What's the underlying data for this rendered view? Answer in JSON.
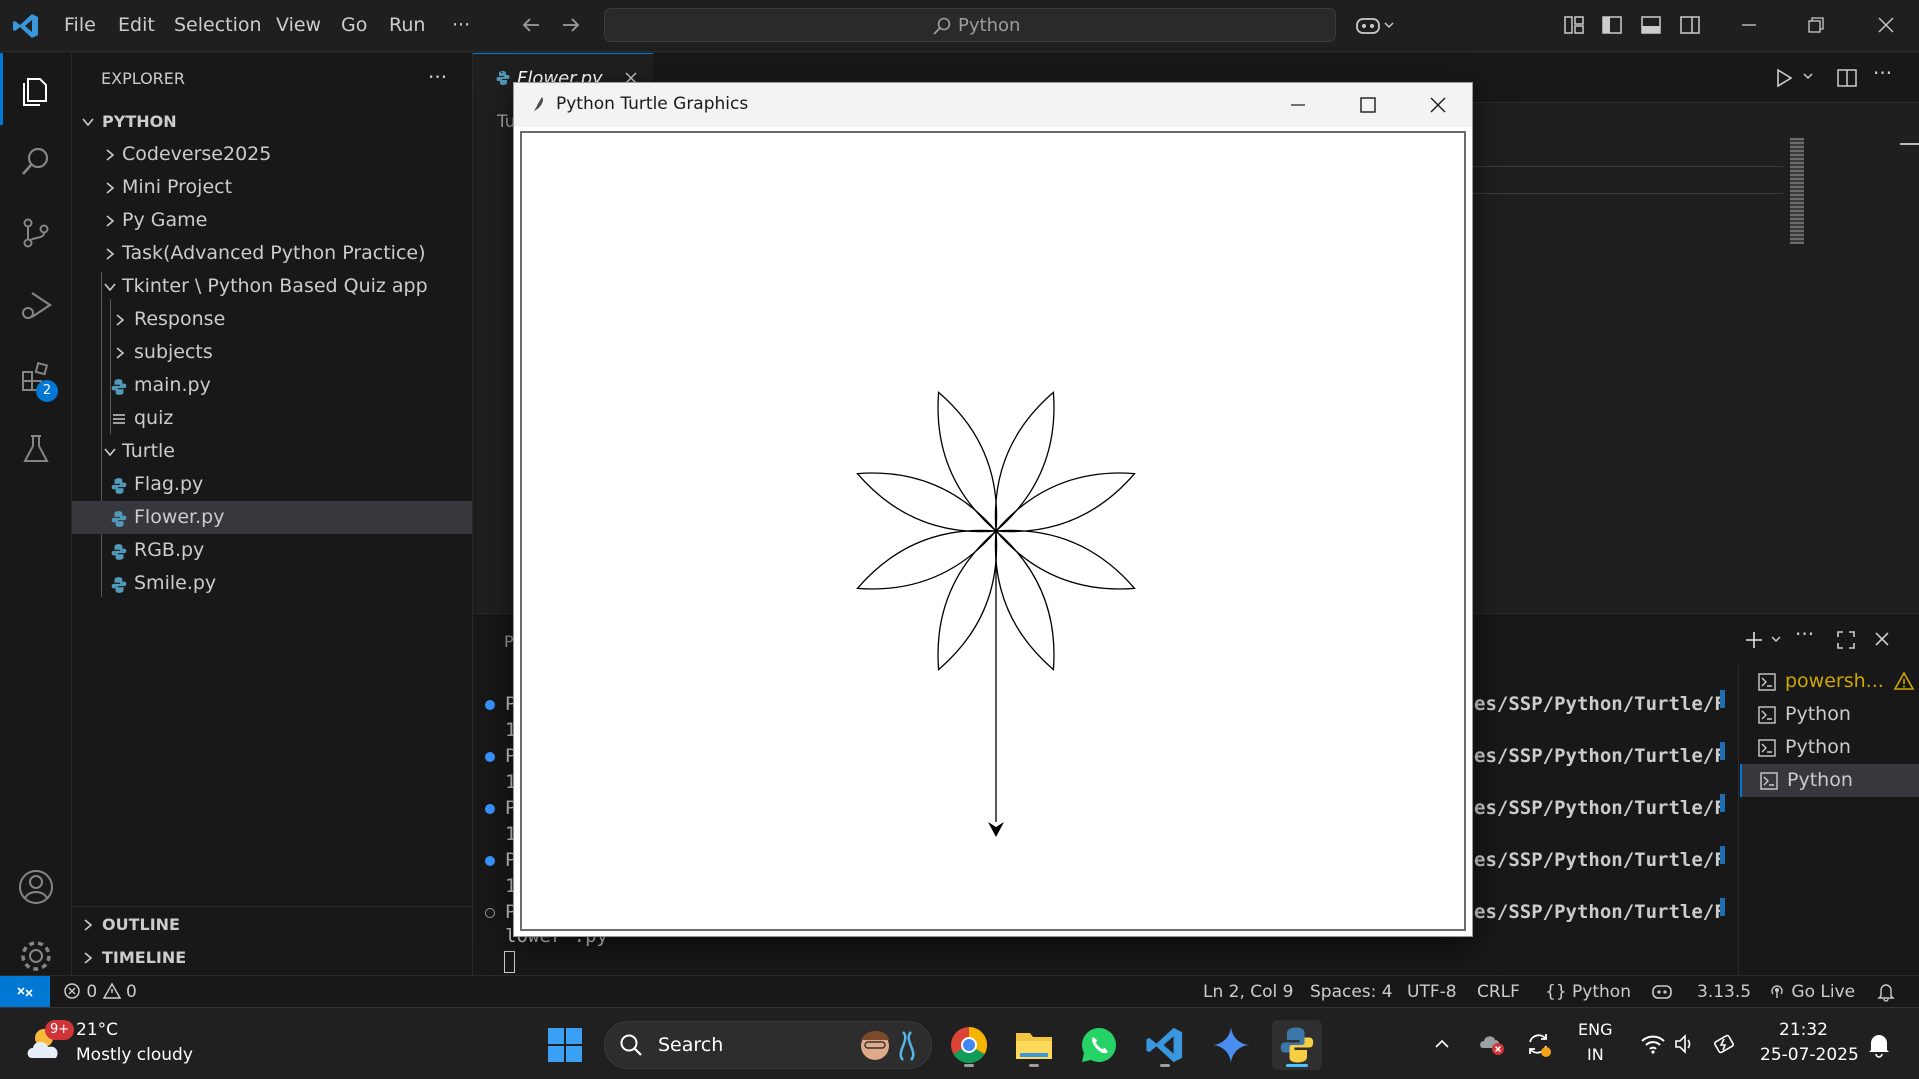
{
  "titlebar": {
    "menu": [
      "File",
      "Edit",
      "Selection",
      "View",
      "Go",
      "Run",
      "···"
    ],
    "search_text": "Python"
  },
  "activitybar": {
    "extensions_badge": "2"
  },
  "explorer": {
    "title": "EXPLORER",
    "section": "PYTHON",
    "items": [
      {
        "label": "Codeverse2025",
        "kind": "folder"
      },
      {
        "label": "Mini Project",
        "kind": "folder"
      },
      {
        "label": "Py Game",
        "kind": "folder"
      },
      {
        "label": "Task(Advanced Python Practice)",
        "kind": "folder"
      },
      {
        "label": "Tkinter \\ Python Based Quiz app",
        "kind": "folder-open"
      },
      {
        "label": "Response",
        "kind": "folder"
      },
      {
        "label": "subjects",
        "kind": "folder"
      },
      {
        "label": "main.py",
        "kind": "python"
      },
      {
        "label": "quiz",
        "kind": "text"
      },
      {
        "label": "Turtle",
        "kind": "folder-open"
      },
      {
        "label": "Flag.py",
        "kind": "python"
      },
      {
        "label": "Flower.py",
        "kind": "python"
      },
      {
        "label": "RGB.py",
        "kind": "python"
      },
      {
        "label": "Smile.py",
        "kind": "python"
      }
    ],
    "outline": "OUTLINE",
    "timeline": "TIMELINE"
  },
  "editor": {
    "active_tab": "Flower.py",
    "breadcrumb_partial": "Tu"
  },
  "panel": {
    "tab_partial": "P",
    "terminal_lines": [
      "es/SSP/Python/Turtle/F",
      "es/SSP/Python/Turtle/F",
      "es/SSP/Python/Turtle/F",
      "es/SSP/Python/Turtle/F",
      "es/SSP/Python/Turtle/F"
    ],
    "left_fragments": [
      "P",
      "1",
      "P",
      "1",
      "P",
      "1",
      "P",
      "1",
      "P"
    ],
    "last_line": "lower'.py",
    "terminals": [
      {
        "label": "powersh...",
        "warning": true
      },
      {
        "label": "Python",
        "warning": false
      },
      {
        "label": "Python",
        "warning": false
      },
      {
        "label": "Python",
        "warning": false
      }
    ]
  },
  "turtle_window": {
    "title": "Python Turtle Graphics"
  },
  "statusbar": {
    "errors": "0",
    "warnings": "0",
    "position": "Ln 2, Col 9",
    "spaces": "Spaces: 4",
    "encoding": "UTF-8",
    "eol": "CRLF",
    "language": "Python",
    "version": "3.13.5",
    "golive": "Go Live"
  },
  "taskbar": {
    "weather_badge": "9+",
    "temperature": "21°C",
    "weather": "Mostly cloudy",
    "search": "Search",
    "lang_top": "ENG",
    "lang_bottom": "IN",
    "time": "21:32",
    "date": "25-07-2025"
  },
  "colors": {
    "accent": "#0078d4",
    "python_icon": "#519aba",
    "warning": "#cca700"
  }
}
